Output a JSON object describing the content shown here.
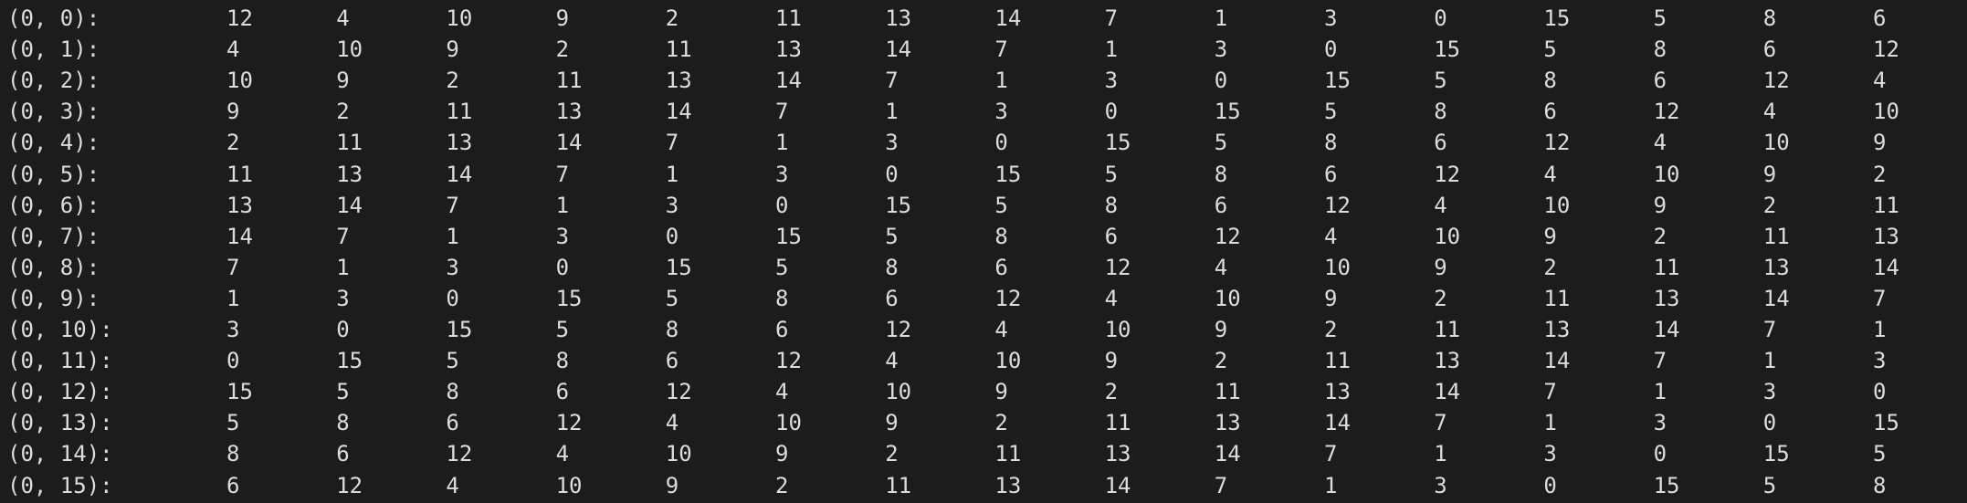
{
  "terminal": {
    "rows": [
      {
        "label": "(0, 0):",
        "values": [
          "12",
          "4",
          "10",
          "9",
          "2",
          "11",
          "13",
          "14",
          "7",
          "1",
          "3",
          "0",
          "15",
          "5",
          "8",
          "6"
        ]
      },
      {
        "label": "(0, 1):",
        "values": [
          "4",
          "10",
          "9",
          "2",
          "11",
          "13",
          "14",
          "7",
          "1",
          "3",
          "0",
          "15",
          "5",
          "8",
          "6",
          "12"
        ]
      },
      {
        "label": "(0, 2):",
        "values": [
          "10",
          "9",
          "2",
          "11",
          "13",
          "14",
          "7",
          "1",
          "3",
          "0",
          "15",
          "5",
          "8",
          "6",
          "12",
          "4"
        ]
      },
      {
        "label": "(0, 3):",
        "values": [
          "9",
          "2",
          "11",
          "13",
          "14",
          "7",
          "1",
          "3",
          "0",
          "15",
          "5",
          "8",
          "6",
          "12",
          "4",
          "10"
        ]
      },
      {
        "label": "(0, 4):",
        "values": [
          "2",
          "11",
          "13",
          "14",
          "7",
          "1",
          "3",
          "0",
          "15",
          "5",
          "8",
          "6",
          "12",
          "4",
          "10",
          "9"
        ]
      },
      {
        "label": "(0, 5):",
        "values": [
          "11",
          "13",
          "14",
          "7",
          "1",
          "3",
          "0",
          "15",
          "5",
          "8",
          "6",
          "12",
          "4",
          "10",
          "9",
          "2"
        ]
      },
      {
        "label": "(0, 6):",
        "values": [
          "13",
          "14",
          "7",
          "1",
          "3",
          "0",
          "15",
          "5",
          "8",
          "6",
          "12",
          "4",
          "10",
          "9",
          "2",
          "11"
        ]
      },
      {
        "label": "(0, 7):",
        "values": [
          "14",
          "7",
          "1",
          "3",
          "0",
          "15",
          "5",
          "8",
          "6",
          "12",
          "4",
          "10",
          "9",
          "2",
          "11",
          "13"
        ]
      },
      {
        "label": "(0, 8):",
        "values": [
          "7",
          "1",
          "3",
          "0",
          "15",
          "5",
          "8",
          "6",
          "12",
          "4",
          "10",
          "9",
          "2",
          "11",
          "13",
          "14"
        ]
      },
      {
        "label": "(0, 9):",
        "values": [
          "1",
          "3",
          "0",
          "15",
          "5",
          "8",
          "6",
          "12",
          "4",
          "10",
          "9",
          "2",
          "11",
          "13",
          "14",
          "7"
        ]
      },
      {
        "label": "(0, 10):",
        "values": [
          "3",
          "0",
          "15",
          "5",
          "8",
          "6",
          "12",
          "4",
          "10",
          "9",
          "2",
          "11",
          "13",
          "14",
          "7",
          "1"
        ]
      },
      {
        "label": "(0, 11):",
        "values": [
          "0",
          "15",
          "5",
          "8",
          "6",
          "12",
          "4",
          "10",
          "9",
          "2",
          "11",
          "13",
          "14",
          "7",
          "1",
          "3"
        ]
      },
      {
        "label": "(0, 12):",
        "values": [
          "15",
          "5",
          "8",
          "6",
          "12",
          "4",
          "10",
          "9",
          "2",
          "11",
          "13",
          "14",
          "7",
          "1",
          "3",
          "0"
        ]
      },
      {
        "label": "(0, 13):",
        "values": [
          "5",
          "8",
          "6",
          "12",
          "4",
          "10",
          "9",
          "2",
          "11",
          "13",
          "14",
          "7",
          "1",
          "3",
          "0",
          "15"
        ]
      },
      {
        "label": "(0, 14):",
        "values": [
          "8",
          "6",
          "12",
          "4",
          "10",
          "9",
          "2",
          "11",
          "13",
          "14",
          "7",
          "1",
          "3",
          "0",
          "15",
          "5"
        ]
      },
      {
        "label": "(0, 15):",
        "values": [
          "6",
          "12",
          "4",
          "10",
          "9",
          "2",
          "11",
          "13",
          "14",
          "7",
          "1",
          "3",
          "0",
          "15",
          "5",
          "8"
        ]
      }
    ]
  }
}
